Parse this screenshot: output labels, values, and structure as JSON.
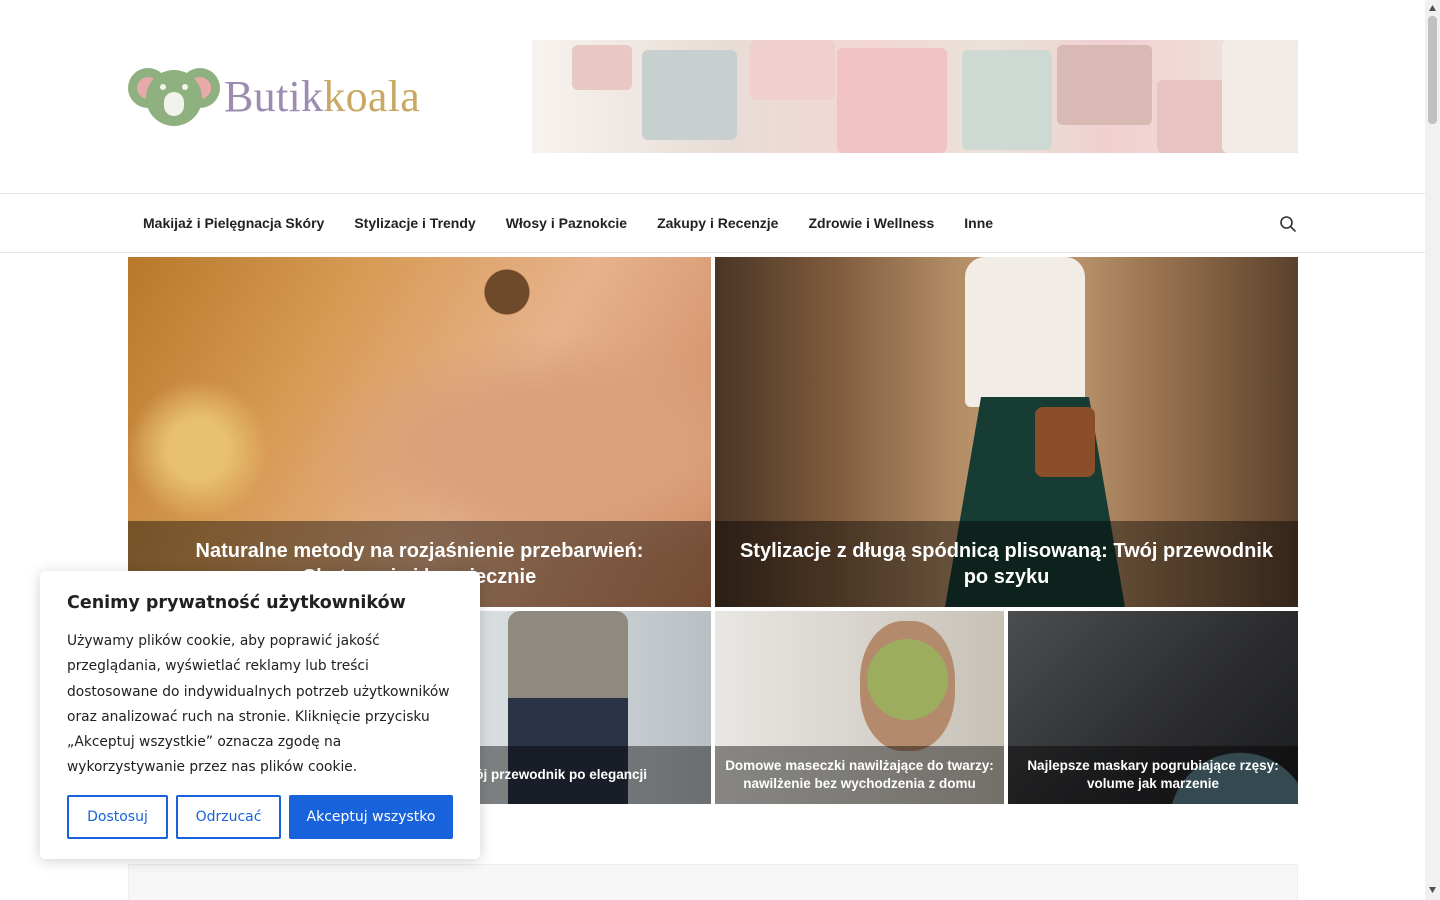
{
  "brand": {
    "name_part1": "Butik",
    "name_part2": "koala"
  },
  "nav": {
    "items": [
      "Makijaż i Pielęgnacja Skóry",
      "Stylizacje i Trendy",
      "Włosy i Paznokcie",
      "Zakupy i Recenzje",
      "Zdrowie i Wellness",
      "Inne"
    ],
    "search_icon": "search-icon"
  },
  "posts": {
    "featured_1": "Naturalne metody na rozjaśnienie przebarwień: Skutecznie i bezpiecznie",
    "featured_2": "Stylizacje z długą spódnicą plisowaną: Twój przewodnik po szyku",
    "small_1": "Stylizacje do pracy biurowej casual chic: Twój przewodnik po elegancji",
    "small_2": "Domowe maseczki nawilżające do twarzy: nawilżenie bez wychodzenia z domu",
    "small_3": "Najlepsze maskary pogrubiające rzęsy: volume jak marzenie"
  },
  "cookie": {
    "title": "Cenimy prywatność użytkowników",
    "body": "Używamy plików cookie, aby poprawić jakość przeglądania, wyświetlać reklamy lub treści dostosowane do indywidualnych potrzeb użytkowników oraz analizować ruch na stronie. Kliknięcie przycisku „Akceptuj wszystkie” oznacza zgodę na wykorzystywanie przez nas plików cookie.",
    "customize": "Dostosuj",
    "reject": "Odrzucać",
    "accept": "Akceptuj wszystko"
  },
  "colors": {
    "accent": "#1863dc",
    "logo_green": "#8fb07f",
    "logo_purple": "#9c8cb0",
    "logo_gold": "#c9a764"
  }
}
